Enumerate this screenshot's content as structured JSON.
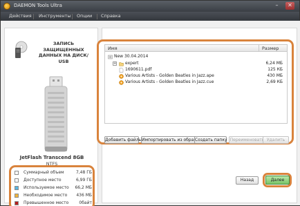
{
  "window": {
    "title": "DAEMON Tools Ultra"
  },
  "menu": [
    {
      "label": "Действия"
    },
    {
      "label": "Инструменты"
    },
    {
      "label": "Опции"
    },
    {
      "label": "Справка"
    }
  ],
  "left_panel": {
    "heading": "ЗАПИСЬ\nЗАЩИЩЕННЫХ\nДАННЫХ НА ДИСК/\nUSB",
    "device_name": "JetFlash Transcend 8GB",
    "filesystem": "NTFS"
  },
  "stats": [
    {
      "label": "Суммарный объем",
      "value": "7,48 ГБ",
      "color": "#ffffff"
    },
    {
      "label": "Доступное место",
      "value": "6,99 ГБ",
      "color": "#ffffff"
    },
    {
      "label": "Используемое место",
      "value": "66,2 МБ",
      "color": "#5ab4e0"
    },
    {
      "label": "Необходимое место",
      "value": "436 МБ",
      "color": "#f0b43c"
    },
    {
      "label": "Превышенное место",
      "value": "0байт",
      "color": "#b41e1e"
    }
  ],
  "files": {
    "columns": {
      "name": "Имя",
      "size": "Размер"
    },
    "rows": [
      {
        "name": "New 30.04.2014",
        "size": "",
        "icon": "disc-icon",
        "level": 0,
        "expander": ""
      },
      {
        "name": "expert",
        "size": "6,24 МБ",
        "icon": "folder-icon",
        "level": 1,
        "expander": "+"
      },
      {
        "name": "1690611.pdf",
        "size": "125 КБ",
        "icon": "file-icon",
        "level": 1,
        "expander": ""
      },
      {
        "name": "Various Artists - Golden Beatles in Jazz.ape",
        "size": "430 МБ",
        "icon": "audio-icon",
        "level": 1,
        "expander": ""
      },
      {
        "name": "Various Artists - Golden Beatles in Jazz.cue",
        "size": "2,69 КБ",
        "icon": "audio-icon",
        "level": 1,
        "expander": ""
      }
    ]
  },
  "buttons": {
    "add_files": "Добавить файлы",
    "import_from_image": "Импортировать из образа",
    "create_folder": "Создать папку",
    "rename": "Переименовать",
    "delete": "Удалить",
    "back": "Назад",
    "next": "Далее"
  },
  "colors": {
    "accent": "#d9833c",
    "next_button": "#79c468"
  }
}
